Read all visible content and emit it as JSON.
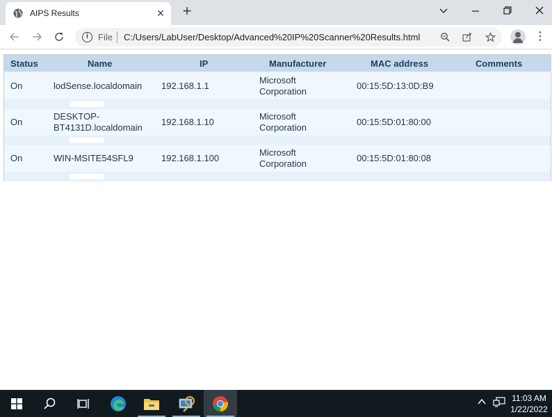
{
  "browser": {
    "tab_title": "AIPS Results",
    "url_scheme": "File",
    "url": "C:/Users/LabUser/Desktop/Advanced%20IP%20Scanner%20Results.html"
  },
  "table": {
    "headers": [
      "Status",
      "Name",
      "IP",
      "Manufacturer",
      "MAC address",
      "Comments"
    ],
    "rows": [
      {
        "status": "On",
        "name_line1": "lodSense.localdomain",
        "name_line2": "",
        "ip": "192.168.1.1",
        "manufacturer_line1": "Microsoft",
        "manufacturer_line2": "Corporation",
        "mac": "00:15:5D:13:0D:B9",
        "comments": ""
      },
      {
        "status": "On",
        "name_line1": "DESKTOP-",
        "name_line2": "BT4131D.localdomain",
        "ip": "192.168.1.10",
        "manufacturer_line1": "Microsoft",
        "manufacturer_line2": "Corporation",
        "mac": "00:15:5D:01:80:00",
        "comments": ""
      },
      {
        "status": "On",
        "name_line1": "WIN-MSITE54SFL9",
        "name_line2": "",
        "ip": "192.168.1.100",
        "manufacturer_line1": "Microsoft",
        "manufacturer_line2": "Corporation",
        "mac": "00:15:5D:01:80:08",
        "comments": ""
      }
    ]
  },
  "taskbar": {
    "time": "11:03 AM",
    "date": "1/22/2022",
    "apps": [
      "windows-start",
      "search",
      "task-view",
      "edge",
      "file-explorer",
      "network-scanner",
      "chrome"
    ]
  },
  "colors": {
    "header_bg": "#c6d9ea",
    "row_bg": "#f0f7fd",
    "taskbar_bg": "#101a1f"
  }
}
